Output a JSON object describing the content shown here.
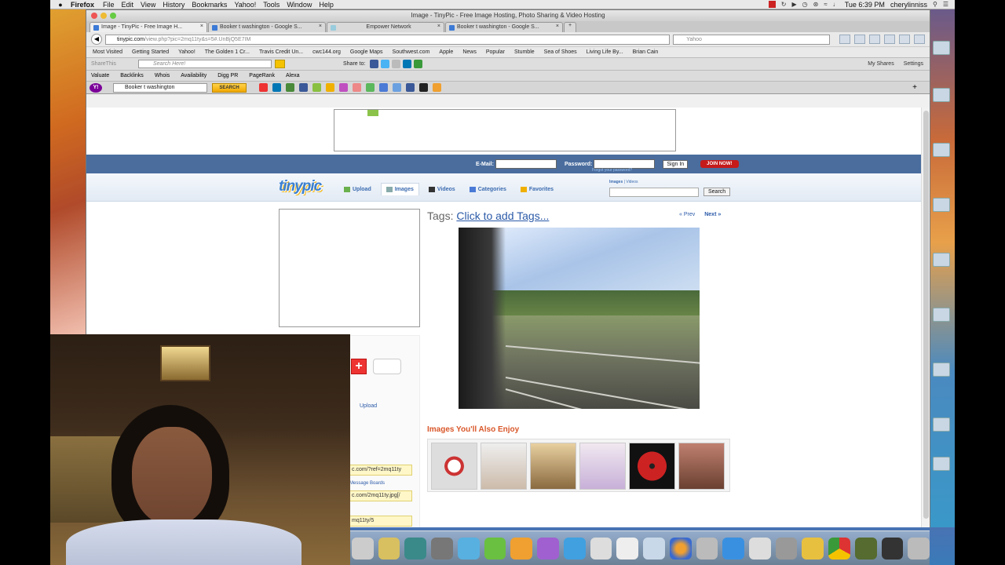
{
  "menubar": {
    "app": "Firefox",
    "items": [
      "File",
      "Edit",
      "View",
      "History",
      "Bookmarks",
      "Yahoo!",
      "Tools",
      "Window",
      "Help"
    ],
    "clock": "Tue 6:39 PM",
    "user": "cherylinniss"
  },
  "window": {
    "title": "Image - TinyPic - Free Image Hosting, Photo Sharing & Video Hosting",
    "tabs": [
      {
        "label": "Image - TinyPic - Free Image H...",
        "active": true
      },
      {
        "label": "Booker t washington - Google S...",
        "active": false
      },
      {
        "label": "Empower Network",
        "active": false
      },
      {
        "label": "Booker t washington - Google S...",
        "active": false
      }
    ],
    "url_host": "tinypic.com",
    "url_path": "/view.php?pic=2mq11ty&s=5#.UnBjQ5E7IM",
    "search_placeholder": "Yahoo"
  },
  "bookmarks": [
    "Most Visited",
    "Getting Started",
    "Yahoo!",
    "The Golden 1 Cr...",
    "Travis Credit Un...",
    "cwc144.org",
    "Google Maps",
    "Southwest.com",
    "Apple",
    "News",
    "Popular",
    "Stumble",
    "Sea of Shoes",
    "Living Life By...",
    "Brian Cain"
  ],
  "sharebar": {
    "brand": "ShareThis",
    "search_placeholder": "Search Here!",
    "share_to": "Share to:",
    "my_shares": "My Shares",
    "settings": "Settings"
  },
  "seobar": [
    "Valuate",
    "Backlinks",
    "Whois",
    "Availability",
    "Digg PR",
    "PageRank",
    "Alexa"
  ],
  "yahoobar": {
    "query": "Booker t washington",
    "search_button": "SEARCH"
  },
  "page": {
    "login": {
      "email_label": "E-Mail:",
      "password_label": "Password:",
      "signin": "Sign In",
      "join": "JOIN NOW!",
      "forgot": "Forgot your password?"
    },
    "logo": "tinypic",
    "nav": [
      "Upload",
      "Images",
      "Videos",
      "Categories",
      "Favorites"
    ],
    "search_tab_images": "Images",
    "search_tab_sep": "|",
    "search_tab_videos": "Videos",
    "search_button": "Search",
    "tags_label": "Tags:",
    "tags_link": "Click to add Tags...",
    "prev": "« Prev",
    "next": "Next »",
    "also_enjoy": "Images You'll Also Enjoy",
    "left_upload": "Upload",
    "link1": "c.com/?ref=2mq11ty",
    "message_boards": "Message Boards",
    "link2": "c.com/2mq11ty.jpg[/",
    "link3": "mq11ty/5"
  },
  "colors": {
    "login_bar": "#4a6d9e",
    "join_button": "#c51a1a",
    "also_enjoy": "#d9572a",
    "link": "#2b5aa8"
  }
}
